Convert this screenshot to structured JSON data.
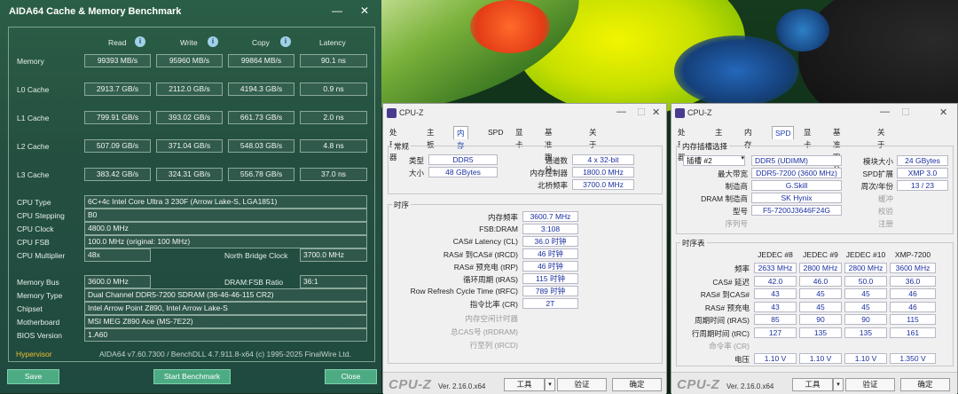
{
  "aida": {
    "title": "AIDA64 Cache & Memory Benchmark",
    "minimize": "—",
    "close": "✕",
    "columns": [
      "Read",
      "Write",
      "Copy",
      "Latency"
    ],
    "rows": [
      {
        "label": "Memory",
        "read": "99393 MB/s",
        "write": "95960 MB/s",
        "copy": "99864 MB/s",
        "latency": "90.1 ns"
      },
      {
        "label": "L0 Cache",
        "read": "2913.7 GB/s",
        "write": "2112.0 GB/s",
        "copy": "4194.3 GB/s",
        "latency": "0.9 ns"
      },
      {
        "label": "L1 Cache",
        "read": "799.91 GB/s",
        "write": "393.02 GB/s",
        "copy": "661.73 GB/s",
        "latency": "2.0 ns"
      },
      {
        "label": "L2 Cache",
        "read": "507.09 GB/s",
        "write": "371.04 GB/s",
        "copy": "548.03 GB/s",
        "latency": "4.8 ns"
      },
      {
        "label": "L3 Cache",
        "read": "383.42 GB/s",
        "write": "324.31 GB/s",
        "copy": "556.78 GB/s",
        "latency": "37.0 ns"
      }
    ],
    "cpu": {
      "type_label": "CPU Type",
      "type": "6C+4c Intel Core Ultra 3 230F  (Arrow Lake-S, LGA1851)",
      "stepping_label": "CPU Stepping",
      "stepping": "B0",
      "clock_label": "CPU Clock",
      "clock": "4800.0 MHz",
      "fsb_label": "CPU FSB",
      "fsb": "100.0 MHz  (original: 100 MHz)",
      "mult_label": "CPU Multiplier",
      "mult": "48x",
      "nb_label": "North Bridge Clock",
      "nb": "3700.0 MHz"
    },
    "mem": {
      "bus_label": "Memory Bus",
      "bus": "3600.0 MHz",
      "ratio_label": "DRAM:FSB Ratio",
      "ratio": "36:1",
      "type_label": "Memory Type",
      "type": "Dual Channel DDR5-7200 SDRAM  (36-46-46-115 CR2)",
      "chipset_label": "Chipset",
      "chipset": "Intel Arrow Point Z890, Intel Arrow Lake-S",
      "mobo_label": "Motherboard",
      "mobo": "MSI MEG Z890 Ace (MS-7E22)",
      "bios_label": "BIOS Version",
      "bios": "1.A60"
    },
    "hypervisor": "Hypervisor",
    "version_line": "AIDA64 v7.60.7300 / BenchDLL 4.7.911.8-x64  (c) 1995-2025 FinalWire Ltd.",
    "buttons": {
      "save": "Save",
      "start": "Start Benchmark",
      "close": "Close"
    }
  },
  "cpuz1": {
    "title": "CPU-Z",
    "tabs": [
      "处理器",
      "主板",
      "内存",
      "SPD",
      "显卡",
      "基准跑分",
      "关于"
    ],
    "general": {
      "title": "常规",
      "type_label": "类型",
      "type": "DDR5",
      "size_label": "大小",
      "size": "48 GBytes",
      "channels_label": "通道数",
      "channels": "4 x 32-bit",
      "mc_label": "内存控制器",
      "mc": "1800.0 MHz",
      "nb_label": "北桥频率",
      "nb": "3700.0 MHz"
    },
    "timings": {
      "title": "时序",
      "rows": [
        {
          "label": "内存频率",
          "value": "3600.7 MHz",
          "dim": false
        },
        {
          "label": "FSB:DRAM",
          "value": "3:108",
          "dim": false
        },
        {
          "label": "CAS# Latency (CL)",
          "value": "36.0 时钟",
          "dim": false
        },
        {
          "label": "RAS# 到CAS# (tRCD)",
          "value": "46 时钟",
          "dim": false
        },
        {
          "label": "RAS# 预充电 (tRP)",
          "value": "46 时钟",
          "dim": false
        },
        {
          "label": "循环周期 (tRAS)",
          "value": "115 时钟",
          "dim": false
        },
        {
          "label": "Row Refresh Cycle Time (tRFC)",
          "value": "789 时钟",
          "dim": false
        },
        {
          "label": "指令比率 (CR)",
          "value": "2T",
          "dim": false
        },
        {
          "label": "内存空闲计时器",
          "value": "",
          "dim": true
        },
        {
          "label": "总CAS号 (tRDRAM)",
          "value": "",
          "dim": true
        },
        {
          "label": "行至列 (tRCD)",
          "value": "",
          "dim": true
        }
      ]
    },
    "brand": "CPU-Z",
    "version": "Ver. 2.16.0.x64",
    "tools": "工具",
    "validate": "验证",
    "ok": "确定"
  },
  "cpuz2": {
    "title": "CPU-Z",
    "tabs": [
      "处理器",
      "主板",
      "内存",
      "SPD",
      "显卡",
      "基准跑分",
      "关于"
    ],
    "slot": {
      "title": "内存插槽选择",
      "select": "插槽 #2",
      "module_type": "DDR5 (UDIMM)",
      "size_label": "模块大小",
      "size": "24 GBytes",
      "bw_label": "最大带宽",
      "bw": "DDR5-7200 (3600 MHz)",
      "spd_label": "SPD扩展",
      "spd": "XMP 3.0",
      "mfr_label": "制造商",
      "mfr": "G.Skill",
      "week_label": "周次/年份",
      "week": "13 / 23",
      "dram_label": "DRAM 制造商",
      "dram": "SK Hynix",
      "buffer_label": "缓冲",
      "part_label": "型号",
      "part": "F5-7200J3646F24G",
      "check_label": "校验",
      "serial_label": "序列号",
      "reg_label": "注册"
    },
    "timing_table": {
      "title": "时序表",
      "headers": [
        "JEDEC #8",
        "JEDEC #9",
        "JEDEC #10",
        "XMP-7200"
      ],
      "rows": [
        {
          "label": "频率",
          "values": [
            "2633 MHz",
            "2800 MHz",
            "2800 MHz",
            "3600 MHz"
          ],
          "dim": false
        },
        {
          "label": "CAS# 延迟",
          "values": [
            "42.0",
            "46.0",
            "50.0",
            "36.0"
          ],
          "dim": false
        },
        {
          "label": "RAS# 到CAS#",
          "values": [
            "43",
            "45",
            "45",
            "46"
          ],
          "dim": false
        },
        {
          "label": "RAS# 预充电",
          "values": [
            "43",
            "45",
            "45",
            "46"
          ],
          "dim": false
        },
        {
          "label": "周期时间 (tRAS)",
          "values": [
            "85",
            "90",
            "90",
            "115"
          ],
          "dim": false
        },
        {
          "label": "行周期时间 (tRC)",
          "values": [
            "127",
            "135",
            "135",
            "161"
          ],
          "dim": false
        },
        {
          "label": "命令率 (CR)",
          "values": [
            "",
            "",
            "",
            ""
          ],
          "dim": true
        },
        {
          "label": "电压",
          "values": [
            "1.10 V",
            "1.10 V",
            "1.10 V",
            "1.350 V"
          ],
          "dim": false
        }
      ]
    },
    "brand": "CPU-Z",
    "version": "Ver. 2.16.0.x64",
    "tools": "工具",
    "validate": "验证",
    "ok": "确定"
  },
  "colors": {
    "aida_bg": "#244f40",
    "aida_button": "#4cab83",
    "cpuz_value": "#1b2fa0",
    "hypervisor": "#f0c030"
  }
}
